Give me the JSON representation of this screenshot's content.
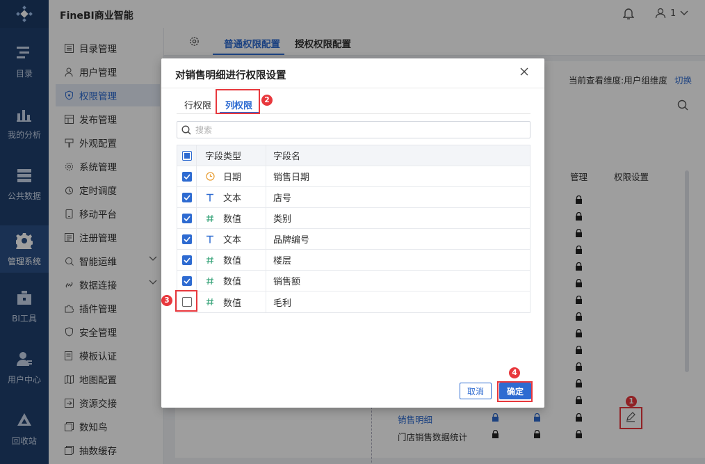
{
  "app": {
    "title": "FineBI商业智能",
    "user": "1"
  },
  "leftnav": [
    {
      "label": "目录",
      "icon": "catalog-icon"
    },
    {
      "label": "我的分析",
      "icon": "analysis-icon"
    },
    {
      "label": "公共数据",
      "icon": "public-data-icon"
    },
    {
      "label": "管理系统",
      "icon": "gear-icon"
    },
    {
      "label": "BI工具",
      "icon": "toolbox-icon"
    },
    {
      "label": "用户中心",
      "icon": "user-center-icon"
    },
    {
      "label": "回收站",
      "icon": "recycle-icon"
    }
  ],
  "subnav": [
    {
      "label": "目录管理"
    },
    {
      "label": "用户管理"
    },
    {
      "label": "权限管理"
    },
    {
      "label": "发布管理"
    },
    {
      "label": "外观配置"
    },
    {
      "label": "系统管理"
    },
    {
      "label": "定时调度"
    },
    {
      "label": "移动平台"
    },
    {
      "label": "注册管理"
    },
    {
      "label": "智能运维"
    },
    {
      "label": "数据连接"
    },
    {
      "label": "插件管理"
    },
    {
      "label": "安全管理"
    },
    {
      "label": "模板认证"
    },
    {
      "label": "地图配置"
    },
    {
      "label": "资源交接"
    },
    {
      "label": "数知鸟"
    },
    {
      "label": "抽数缓存"
    }
  ],
  "tabs": {
    "normal": "普通权限配置",
    "grant": "授权权限配置"
  },
  "background": {
    "dimension_text": "当前查看维度:用户组维度",
    "switch_link": "切换",
    "col_manage": "管理",
    "col_permission": "权限设置",
    "row_sales": "销售明细",
    "row_store": "门店销售数据统计"
  },
  "dialog": {
    "title": "对销售明细进行权限设置",
    "tab_row": "行权限",
    "tab_col": "列权限",
    "search_placeholder": "搜索",
    "col_type": "字段类型",
    "col_name": "字段名",
    "rows": [
      {
        "type": "日期",
        "name": "销售日期",
        "checked": true,
        "icon": "clock-icon"
      },
      {
        "type": "文本",
        "name": "店号",
        "checked": true,
        "icon": "text-type-icon"
      },
      {
        "type": "数值",
        "name": "类别",
        "checked": true,
        "icon": "number-type-icon"
      },
      {
        "type": "文本",
        "name": "品牌编号",
        "checked": true,
        "icon": "text-type-icon"
      },
      {
        "type": "数值",
        "name": "楼层",
        "checked": true,
        "icon": "number-type-icon"
      },
      {
        "type": "数值",
        "name": "销售额",
        "checked": true,
        "icon": "number-type-icon"
      },
      {
        "type": "数值",
        "name": "毛利",
        "checked": false,
        "icon": "number-type-icon"
      }
    ],
    "cancel": "取消",
    "ok": "确定"
  },
  "markers": [
    "1",
    "2",
    "3",
    "4"
  ],
  "colors": {
    "accent": "#2e6bd1",
    "nav": "#1f3f6e",
    "annotation": "#e8383d"
  }
}
